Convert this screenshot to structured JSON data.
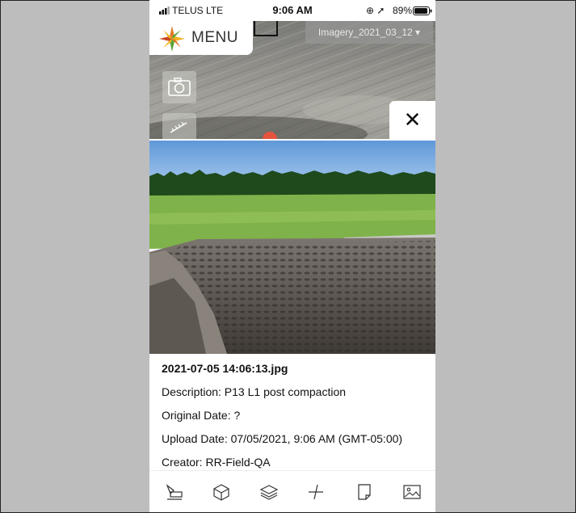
{
  "status_bar": {
    "carrier": "TELUS",
    "network": "LTE",
    "time": "9:06 AM",
    "location_icons": "⊕ ➚",
    "battery": "89%"
  },
  "map": {
    "menu_label": "MENU",
    "imagery_layer": "Imagery_2021_03_12",
    "imagery_caret": "▾"
  },
  "close_label": "✕",
  "photo_info": {
    "filename": "2021-07-05 14:06:13.jpg",
    "description": "Description: P13 L1 post compaction",
    "original_date": "Original Date: ?",
    "upload_date": "Upload Date: 07/05/2021, 9:06 AM (GMT-05:00)",
    "creator": "Creator: RR-Field-QA"
  },
  "toolbar": {
    "tools": [
      "draw-tool",
      "3d-box-tool",
      "layers-tool",
      "measure-tool",
      "notes-tool",
      "photos-tool"
    ]
  },
  "colors": {
    "sky": "#6fa4dd",
    "grass": "#7fb24a",
    "soil": "#6b6560",
    "pin": "#e5533d"
  }
}
